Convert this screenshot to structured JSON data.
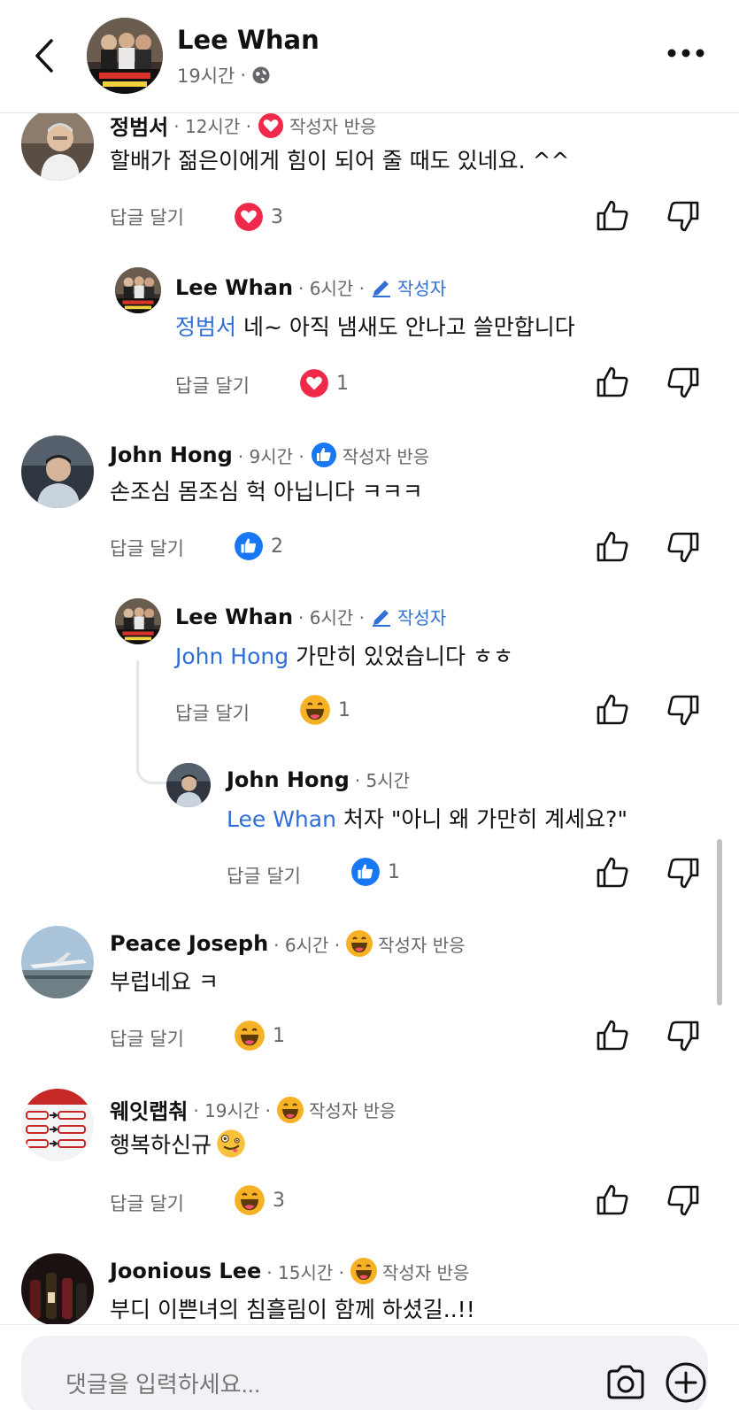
{
  "header": {
    "name": "Lee Whan",
    "time": "19시간",
    "separator": "·"
  },
  "comments": [
    {
      "name": "정범서",
      "time": "· 12시간 ·",
      "badge": "작성자 반응",
      "text": "할배가 젊은이에게  힘이 되어 줄 때도 있네요. ^^",
      "reply_label": "답글 달기",
      "reaction_count": "3"
    },
    {
      "name": "Lee Whan",
      "time": "· 6시간 ·",
      "badge": "작성자",
      "mention": "정범서",
      "text": " 네~ 아직 냄새도 안나고 쓸만합니다",
      "reply_label": "답글 달기",
      "reaction_count": "1"
    },
    {
      "name": "John Hong",
      "time": "· 9시간 ·",
      "badge": "작성자 반응",
      "text": "손조심 몸조심 헉 아닙니다 ㅋㅋㅋ",
      "reply_label": "답글 달기",
      "reaction_count": "2"
    },
    {
      "name": "Lee Whan",
      "time": "· 6시간 ·",
      "badge": "작성자",
      "mention": "John Hong",
      "text": " 가만히 있었습니다 ㅎㅎ",
      "reply_label": "답글 달기",
      "reaction_count": "1"
    },
    {
      "name": "John Hong",
      "time": "· 5시간",
      "mention": "Lee Whan",
      "text": " 처자 \"아니 왜 가만히 계세요?\"",
      "reply_label": "답글 달기",
      "reaction_count": "1"
    },
    {
      "name": "Peace Joseph",
      "time": "· 6시간 ·",
      "badge": "작성자 반응",
      "text": "부럽네요 ㅋ",
      "reply_label": "답글 달기",
      "reaction_count": "1"
    },
    {
      "name": "웨잇랩춰",
      "time": "· 19시간 ·",
      "badge": "작성자 반응",
      "text": "행복하신규",
      "reply_label": "답글 달기",
      "reaction_count": "3"
    },
    {
      "name": "Joonious Lee",
      "time": "· 15시간 ·",
      "badge": "작성자 반응",
      "text": "부디 이쁜녀의 침흘림이 함께 하셨길..!!"
    }
  ],
  "input": {
    "placeholder": "댓글을 입력하세요..."
  },
  "colors": {
    "mention": "#2f6fd6",
    "love": "#f0284a",
    "like": "#1877f2",
    "haha": "#f7b125",
    "meta": "#65676b"
  }
}
